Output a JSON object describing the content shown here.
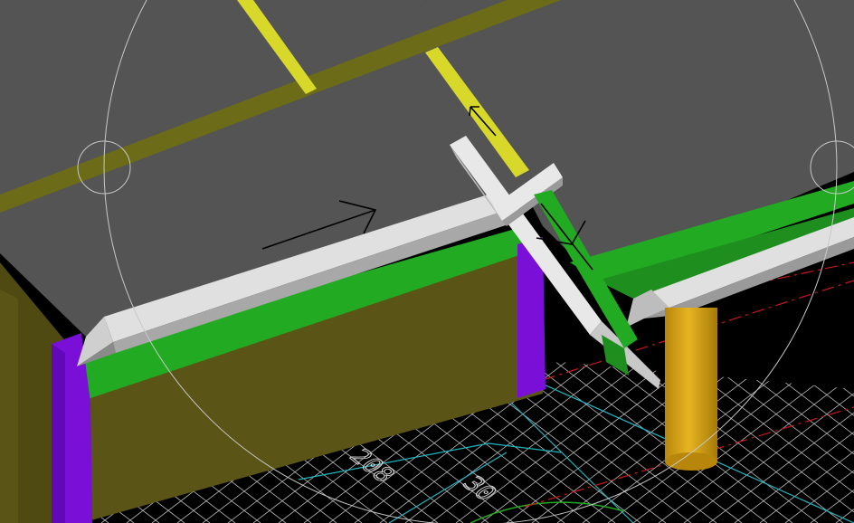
{
  "viewport": {
    "background": "#000000",
    "colors": {
      "roof": "#545454",
      "ridge_yellow": "#d8d82a",
      "ridge_olive": "#6b6b18",
      "wall_olive": "#5a5416",
      "wall_olive_dark": "#4e4a12",
      "fascia_green": "#22aa22",
      "column_purple": "#7a0fd8",
      "gutter_white": "#e0e0e0",
      "gutter_shadow": "#9a9a9a",
      "pillar_gold": "#d6a417",
      "grid_white": "#d8d8d8",
      "grid_cyan": "#1fb6c0",
      "red_dash": "#c81818",
      "orbit_circle": "#c8c8c8",
      "arrow_black": "#000000"
    },
    "dimension_labels": [
      "208",
      "30"
    ]
  }
}
